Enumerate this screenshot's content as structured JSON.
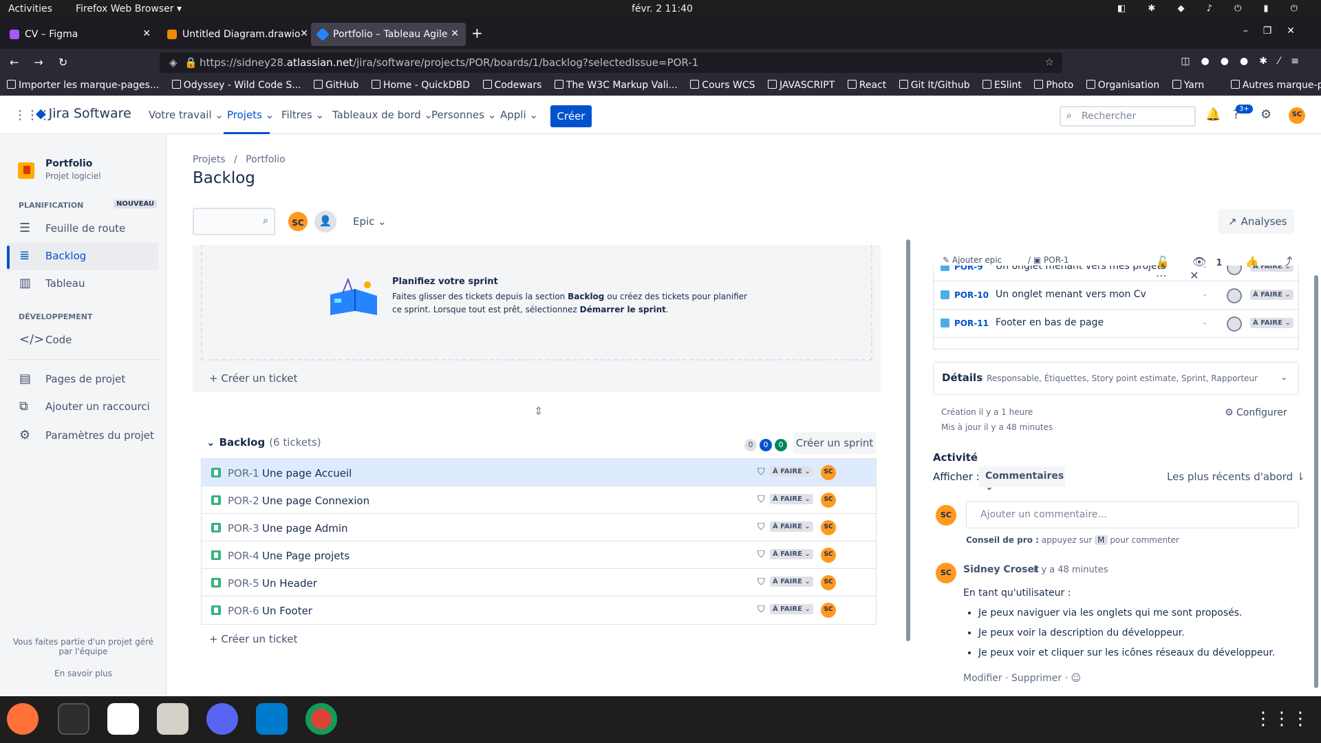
{
  "os": {
    "activities": "Activities",
    "app": "Firefox Web Browser ▾",
    "clock": "févr. 2  11:40",
    "tray": "◧ ✱ ◆ ♪ ⏻ ▮ ⏻"
  },
  "browser": {
    "tabs": [
      {
        "label": "CV – Figma",
        "color": "#a259ff"
      },
      {
        "label": "Untitled Diagram.drawio",
        "color": "#f08705"
      },
      {
        "label": "Portfolio – Tableau Agile",
        "color": "#2684ff"
      }
    ],
    "url_prefix": "https://sidney28.",
    "url_domain": "atlassian.net",
    "url_suffix": "/jira/software/projects/POR/boards/1/backlog?selectedIssue=POR-1",
    "bookmarks": [
      "Importer les marque-pages...",
      "Odyssey - Wild Code S...",
      "GitHub",
      "Home - QuickDBD",
      "Codewars",
      "The W3C Markup Vali...",
      "Cours WCS",
      "JAVASCRIPT",
      "React",
      "Git It/Github",
      "ESlint",
      "Photo",
      "Organisation",
      "Yarn",
      "Autres marque-pages"
    ]
  },
  "jira": {
    "logo": "Jira Software",
    "nav": [
      "Votre travail ⌄",
      "Projets ⌄",
      "Filtres ⌄",
      "Tableaux de bord ⌄",
      "Personnes ⌄",
      "Appli ⌄"
    ],
    "create": "Créer",
    "search_placeholder": "Rechercher",
    "notif_count": "3+",
    "user_initials": "SC"
  },
  "sidebar": {
    "project_name": "Portfolio",
    "project_type": "Projet logiciel",
    "planning": "PLANIFICATION",
    "new_badge": "NOUVEAU",
    "items": [
      "Feuille de route",
      "Backlog",
      "Tableau"
    ],
    "dev": "DÉVELOPPEMENT",
    "code": "Code",
    "links": [
      "Pages de projet",
      "Ajouter un raccourci",
      "Paramètres du projet"
    ],
    "footer": "Vous faites partie d'un projet géré par l'équipe",
    "learn_more": "En savoir plus"
  },
  "board": {
    "crumb_projects": "Projets",
    "crumb_sep": "/",
    "crumb_portfolio": "Portfolio",
    "title": "Backlog",
    "epic": "Epic ⌄",
    "analyses": "Analyses",
    "sprint_title": "Planifiez votre sprint",
    "sprint_desc_1": "Faites glisser des tickets depuis la section ",
    "sprint_desc_b1": "Backlog",
    "sprint_desc_2": " ou créez des tickets pour planifier ce sprint. Lorsque tout est prêt, sélectionnez ",
    "sprint_desc_b2": "Démarrer le sprint",
    "sprint_desc_3": ".",
    "create_ticket": "+ Créer un ticket",
    "backlog_label": "Backlog",
    "backlog_count": "(6 tickets)",
    "pills": [
      "0",
      "0",
      "0"
    ],
    "create_sprint": "Créer un sprint",
    "rows": [
      {
        "key": "POR-1",
        "summary": "Une page Accueil",
        "status": "À FAIRE ⌄",
        "assignee": "SC"
      },
      {
        "key": "POR-2",
        "summary": "Une page Connexion",
        "status": "À FAIRE ⌄",
        "assignee": "SC"
      },
      {
        "key": "POR-3",
        "summary": "Une page Admin",
        "status": "À FAIRE ⌄",
        "assignee": "SC"
      },
      {
        "key": "POR-4",
        "summary": "Une Page projets",
        "status": "À FAIRE ⌄",
        "assignee": "SC"
      },
      {
        "key": "POR-5",
        "summary": "Un Header",
        "status": "À FAIRE ⌄",
        "assignee": "SC"
      },
      {
        "key": "POR-6",
        "summary": "Un Footer",
        "status": "À FAIRE ⌄",
        "assignee": "SC"
      }
    ]
  },
  "detail": {
    "add_epic": "✎ Ajouter epic",
    "key": "/ ▣ POR-1",
    "watchers": "1",
    "subtasks": [
      {
        "key": "POR-9",
        "summary": "Un onglet menant vers mes projets",
        "dash": "-",
        "status": "À FAIRE ⌄"
      },
      {
        "key": "POR-10",
        "summary": "Un onglet menant vers mon Cv",
        "dash": "-",
        "status": "À FAIRE ⌄"
      },
      {
        "key": "POR-11",
        "summary": "Footer en bas de page",
        "dash": "-",
        "status": "À FAIRE ⌄"
      }
    ],
    "details_label": "Détails",
    "details_fields": "Responsable, Étiquettes, Story point estimate, Sprint, Rapporteur",
    "created": "Création il y a 1 heure",
    "updated": "Mis à jour il y a 48 minutes",
    "configure": "⚙ Configurer",
    "activity": "Activité",
    "show": "Afficher :",
    "comments_sel": "Commentaires ⌄",
    "sort": "Les plus récents d'abord ⇂",
    "comment_placeholder": "Ajouter un commentaire...",
    "protip_label": "Conseil de pro :",
    "protip_text": " appuyez sur ",
    "protip_key": "M",
    "protip_end": " pour commenter",
    "author": "Sidney Croset",
    "time": "il y a 48 minutes",
    "intro": "En tant qu'utilisateur :",
    "bullets": [
      "Je peux naviguer via les onglets qui me sont proposés.",
      "Je peux voir la description du développeur.",
      "Je peux voir et cliquer sur les icônes réseaux du développeur."
    ],
    "actions": "Modifier  ·  Supprimer  ·  ☺"
  }
}
